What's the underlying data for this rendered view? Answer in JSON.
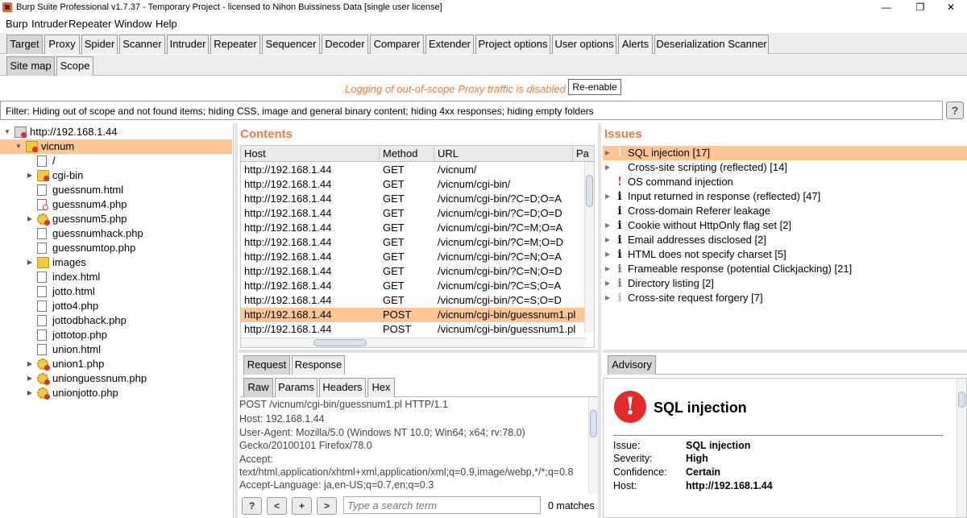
{
  "window": {
    "title": "Burp Suite Professional v1.7.37 - Temporary Project - licensed to Nihon Buissiness Data [single user license]",
    "minimize": "—",
    "maximize": "❐",
    "close": "✕"
  },
  "menu": [
    "Burp",
    "Intruder",
    "Repeater",
    "Window",
    "Help"
  ],
  "main_tabs": [
    "Target",
    "Proxy",
    "Spider",
    "Scanner",
    "Intruder",
    "Repeater",
    "Sequencer",
    "Decoder",
    "Comparer",
    "Extender",
    "Project options",
    "User options",
    "Alerts",
    "Deserialization Scanner"
  ],
  "sub_tabs": [
    "Site map",
    "Scope"
  ],
  "notice": {
    "message": "Logging of out-of-scope Proxy traffic is disabled",
    "button": "Re-enable"
  },
  "filter": {
    "text": "Filter: Hiding out of scope and not found items;  hiding CSS, image and general binary content;  hiding 4xx responses;  hiding empty folders",
    "help": "?"
  },
  "tree": [
    {
      "label": "http://192.168.1.44",
      "depth": 0,
      "arrow": "▼",
      "icon": "host"
    },
    {
      "label": "vicnum",
      "depth": 1,
      "arrow": "▼",
      "icon": "folder",
      "selected": true
    },
    {
      "label": "/",
      "depth": 2,
      "arrow": "",
      "icon": "page"
    },
    {
      "label": "cgi-bin",
      "depth": 2,
      "arrow": "▶",
      "icon": "folder-red"
    },
    {
      "label": "guessnum.html",
      "depth": 2,
      "arrow": "",
      "icon": "page"
    },
    {
      "label": "guessnum4.php",
      "depth": 2,
      "arrow": "",
      "icon": "page-hollow"
    },
    {
      "label": "guessnum5.php",
      "depth": 2,
      "arrow": "▶",
      "icon": "gear"
    },
    {
      "label": "guessnumhack.php",
      "depth": 2,
      "arrow": "",
      "icon": "page"
    },
    {
      "label": "guessnumtop.php",
      "depth": 2,
      "arrow": "",
      "icon": "page"
    },
    {
      "label": "images",
      "depth": 2,
      "arrow": "▶",
      "icon": "folder"
    },
    {
      "label": "index.html",
      "depth": 2,
      "arrow": "",
      "icon": "page"
    },
    {
      "label": "jotto.html",
      "depth": 2,
      "arrow": "",
      "icon": "page"
    },
    {
      "label": "jotto4.php",
      "depth": 2,
      "arrow": "",
      "icon": "page"
    },
    {
      "label": "jottodbhack.php",
      "depth": 2,
      "arrow": "",
      "icon": "page"
    },
    {
      "label": "jottotop.php",
      "depth": 2,
      "arrow": "",
      "icon": "page"
    },
    {
      "label": "union.html",
      "depth": 2,
      "arrow": "",
      "icon": "page"
    },
    {
      "label": "union1.php",
      "depth": 2,
      "arrow": "▶",
      "icon": "gear"
    },
    {
      "label": "unionguessnum.php",
      "depth": 2,
      "arrow": "▶",
      "icon": "gear"
    },
    {
      "label": "unionjotto.php",
      "depth": 2,
      "arrow": "▶",
      "icon": "gear"
    }
  ],
  "contents": {
    "title": "Contents",
    "columns": [
      "Host",
      "Method",
      "URL",
      "Pa"
    ],
    "rows": [
      [
        "http://192.168.1.44",
        "GET",
        "/vicnum/"
      ],
      [
        "http://192.168.1.44",
        "GET",
        "/vicnum/cgi-bin/"
      ],
      [
        "http://192.168.1.44",
        "GET",
        "/vicnum/cgi-bin/?C=D;O=A"
      ],
      [
        "http://192.168.1.44",
        "GET",
        "/vicnum/cgi-bin/?C=D;O=D"
      ],
      [
        "http://192.168.1.44",
        "GET",
        "/vicnum/cgi-bin/?C=M;O=A"
      ],
      [
        "http://192.168.1.44",
        "GET",
        "/vicnum/cgi-bin/?C=M;O=D"
      ],
      [
        "http://192.168.1.44",
        "GET",
        "/vicnum/cgi-bin/?C=N;O=A"
      ],
      [
        "http://192.168.1.44",
        "GET",
        "/vicnum/cgi-bin/?C=N;O=D"
      ],
      [
        "http://192.168.1.44",
        "GET",
        "/vicnum/cgi-bin/?C=S;O=A"
      ],
      [
        "http://192.168.1.44",
        "GET",
        "/vicnum/cgi-bin/?C=S;O=D"
      ],
      [
        "http://192.168.1.44",
        "POST",
        "/vicnum/cgi-bin/guessnum1.pl"
      ],
      [
        "http://192.168.1.44",
        "POST",
        "/vicnum/cgi-bin/guessnum1.pl"
      ]
    ],
    "selected_row": 10
  },
  "issues": {
    "title": "Issues",
    "items": [
      {
        "label": "SQL injection [17]",
        "sev": "high",
        "glyph": "!",
        "selected": true
      },
      {
        "label": "Cross-site scripting (reflected) [14]",
        "sev": "high",
        "glyph": "!"
      },
      {
        "label": "OS command injection",
        "sev": "high-single",
        "glyph": "!"
      },
      {
        "label": "Input returned in response (reflected) [47]",
        "sev": "info",
        "glyph": "i"
      },
      {
        "label": "Cross-domain Referer leakage",
        "sev": "info-single",
        "glyph": "i"
      },
      {
        "label": "Cookie without HttpOnly flag set [2]",
        "sev": "info",
        "glyph": "i"
      },
      {
        "label": "Email addresses disclosed [2]",
        "sev": "info",
        "glyph": "i"
      },
      {
        "label": "HTML does not specify charset [5]",
        "sev": "info",
        "glyph": "i"
      },
      {
        "label": "Frameable response (potential Clickjacking) [21]",
        "sev": "info-light",
        "glyph": "i"
      },
      {
        "label": "Directory listing [2]",
        "sev": "info-light",
        "glyph": "i"
      },
      {
        "label": "Cross-site request forgery [7]",
        "sev": "info-faint",
        "glyph": "i"
      }
    ]
  },
  "request_tabs": [
    "Request",
    "Response"
  ],
  "raw_tabs": [
    "Raw",
    "Params",
    "Headers",
    "Hex"
  ],
  "request_lines": [
    "POST /vicnum/cgi-bin/guessnum1.pl HTTP/1.1",
    "Host: 192.168.1.44",
    "User-Agent: Mozilla/5.0 (Windows NT 10.0; Win64; x64; rv:78.0)",
    "Gecko/20100101 Firefox/78.0",
    "Accept:",
    "text/html,application/xhtml+xml,application/xml;q=0.9,image/webp,*/*;q=0.8",
    "Accept-Language: ja,en-US;q=0.7,en;q=0.3"
  ],
  "search": {
    "help": "?",
    "prev": "<",
    "add": "+",
    "next": ">",
    "placeholder": "Type a search term",
    "matches": "0 matches"
  },
  "advisory": {
    "tab": "Advisory",
    "icon_glyph": "!",
    "title": "SQL injection",
    "fields": [
      {
        "key": "Issue:",
        "value": "SQL injection"
      },
      {
        "key": "Severity:",
        "value": "High"
      },
      {
        "key": "Confidence:",
        "value": "Certain"
      },
      {
        "key": "Host:",
        "value": "http://192.168.1.44"
      }
    ]
  }
}
